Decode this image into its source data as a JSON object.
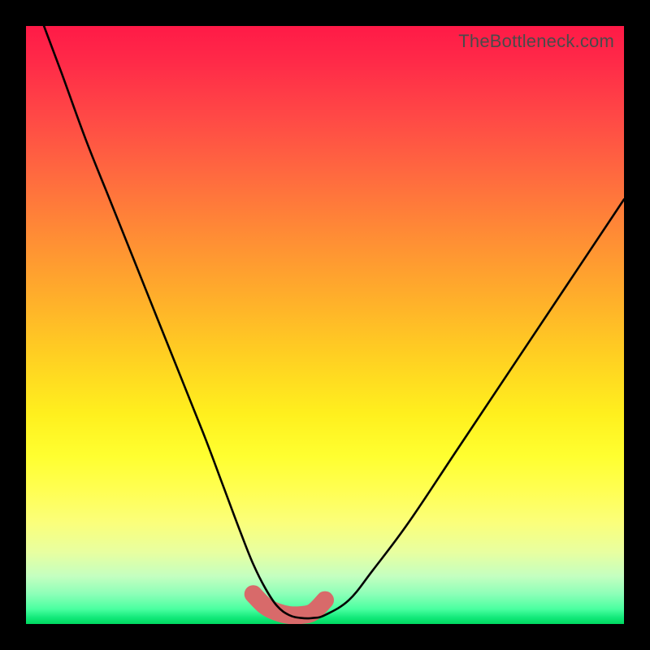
{
  "watermark": "TheBottleneck.com",
  "chart_data": {
    "type": "line",
    "title": "",
    "xlabel": "",
    "ylabel": "",
    "xlim": [
      0,
      100
    ],
    "ylim": [
      0,
      100
    ],
    "series": [
      {
        "name": "bottleneck-curve",
        "x": [
          3,
          6,
          10,
          14,
          18,
          22,
          26,
          30,
          33,
          36,
          38,
          40,
          42,
          44,
          46,
          48,
          50,
          54,
          58,
          64,
          72,
          82,
          92,
          100
        ],
        "y": [
          100,
          92,
          81,
          71,
          61,
          51,
          41,
          31,
          23,
          15,
          10,
          6,
          3,
          1.5,
          1,
          1,
          1.5,
          4,
          9,
          17,
          29,
          44,
          59,
          71
        ]
      },
      {
        "name": "highlight-band",
        "x": [
          38,
          40,
          42,
          44,
          46,
          48,
          50
        ],
        "y": [
          5,
          3,
          2,
          1.5,
          1.5,
          2,
          4
        ]
      }
    ],
    "colors": {
      "curve": "#000000",
      "highlight": "#d86a6a"
    }
  }
}
